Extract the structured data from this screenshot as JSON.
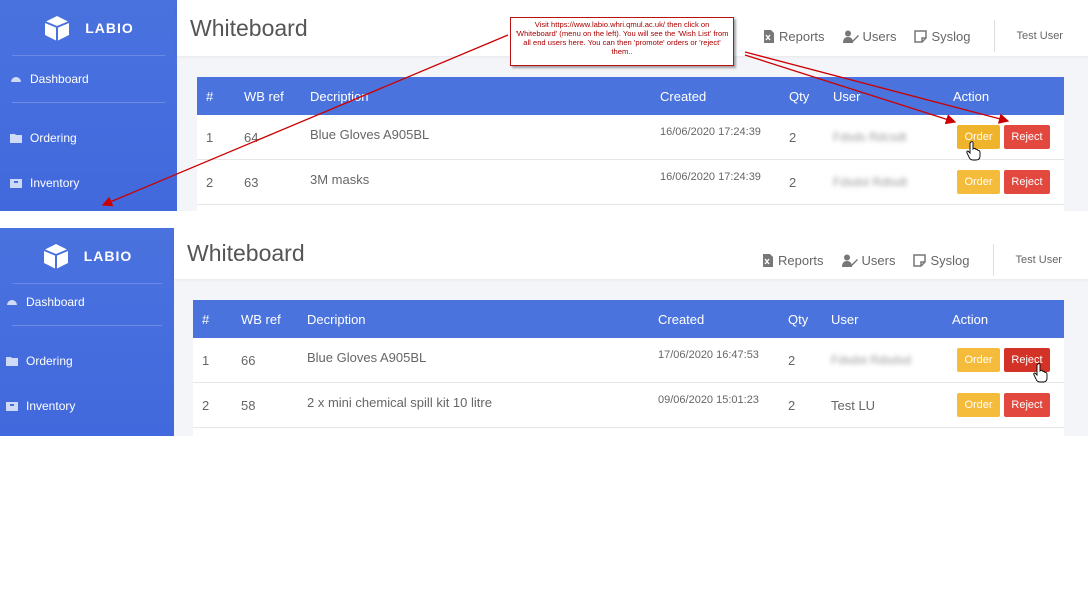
{
  "brand": {
    "name": "LABIO"
  },
  "sidebar": {
    "items": [
      {
        "label": "Dashboard",
        "icon": "dashboard-icon"
      },
      {
        "label": "Ordering",
        "icon": "folder-icon"
      },
      {
        "label": "Inventory",
        "icon": "inventory-icon"
      }
    ]
  },
  "header": {
    "title": "Whiteboard",
    "links": [
      {
        "label": "Reports",
        "icon": "excel-file-icon"
      },
      {
        "label": "Users",
        "icon": "user-edit-icon"
      },
      {
        "label": "Syslog",
        "icon": "note-icon"
      }
    ],
    "user": "Test User"
  },
  "table": {
    "columns": [
      "#",
      "WB ref",
      "Decription",
      "Created",
      "Qty",
      "User",
      "Action"
    ],
    "order_label": "Order",
    "reject_label": "Reject"
  },
  "panel1": {
    "rows": [
      {
        "num": "1",
        "ref": "64",
        "desc": "Blue Gloves A905BL",
        "created": "16/06/2020 17:24:39",
        "qty": "2",
        "user": "Fdsds Rdcsdt",
        "user_blurred": true
      },
      {
        "num": "2",
        "ref": "63",
        "desc": "3M masks",
        "created": "16/06/2020 17:24:39",
        "qty": "2",
        "user": "Fdsdst Rdtsdt",
        "user_blurred": true
      }
    ]
  },
  "panel2": {
    "rows": [
      {
        "num": "1",
        "ref": "66",
        "desc": "Blue Gloves A905BL",
        "created": "17/06/2020 16:47:53",
        "qty": "2",
        "user": "Fdsdst Rdsdsd",
        "user_blurred": true
      },
      {
        "num": "2",
        "ref": "58",
        "desc": "2 x mini chemical spill kit 10 litre",
        "created": "09/06/2020 15:01:23",
        "qty": "2",
        "user": "Test LU",
        "user_blurred": false
      }
    ]
  },
  "annotation": {
    "text": "Visit https://www.labio.whri.qmul.ac.uk/ then click on 'Whiteboard' (menu on the left). You will see the 'Wish List' from all end users here. You can then 'promote' orders or 'reject' them.."
  },
  "colors": {
    "sidebar": "#4169dd",
    "table_header": "#4a73dd",
    "order": "#f5bb3a",
    "reject": "#e2483d",
    "annotation": "#aa0000"
  }
}
